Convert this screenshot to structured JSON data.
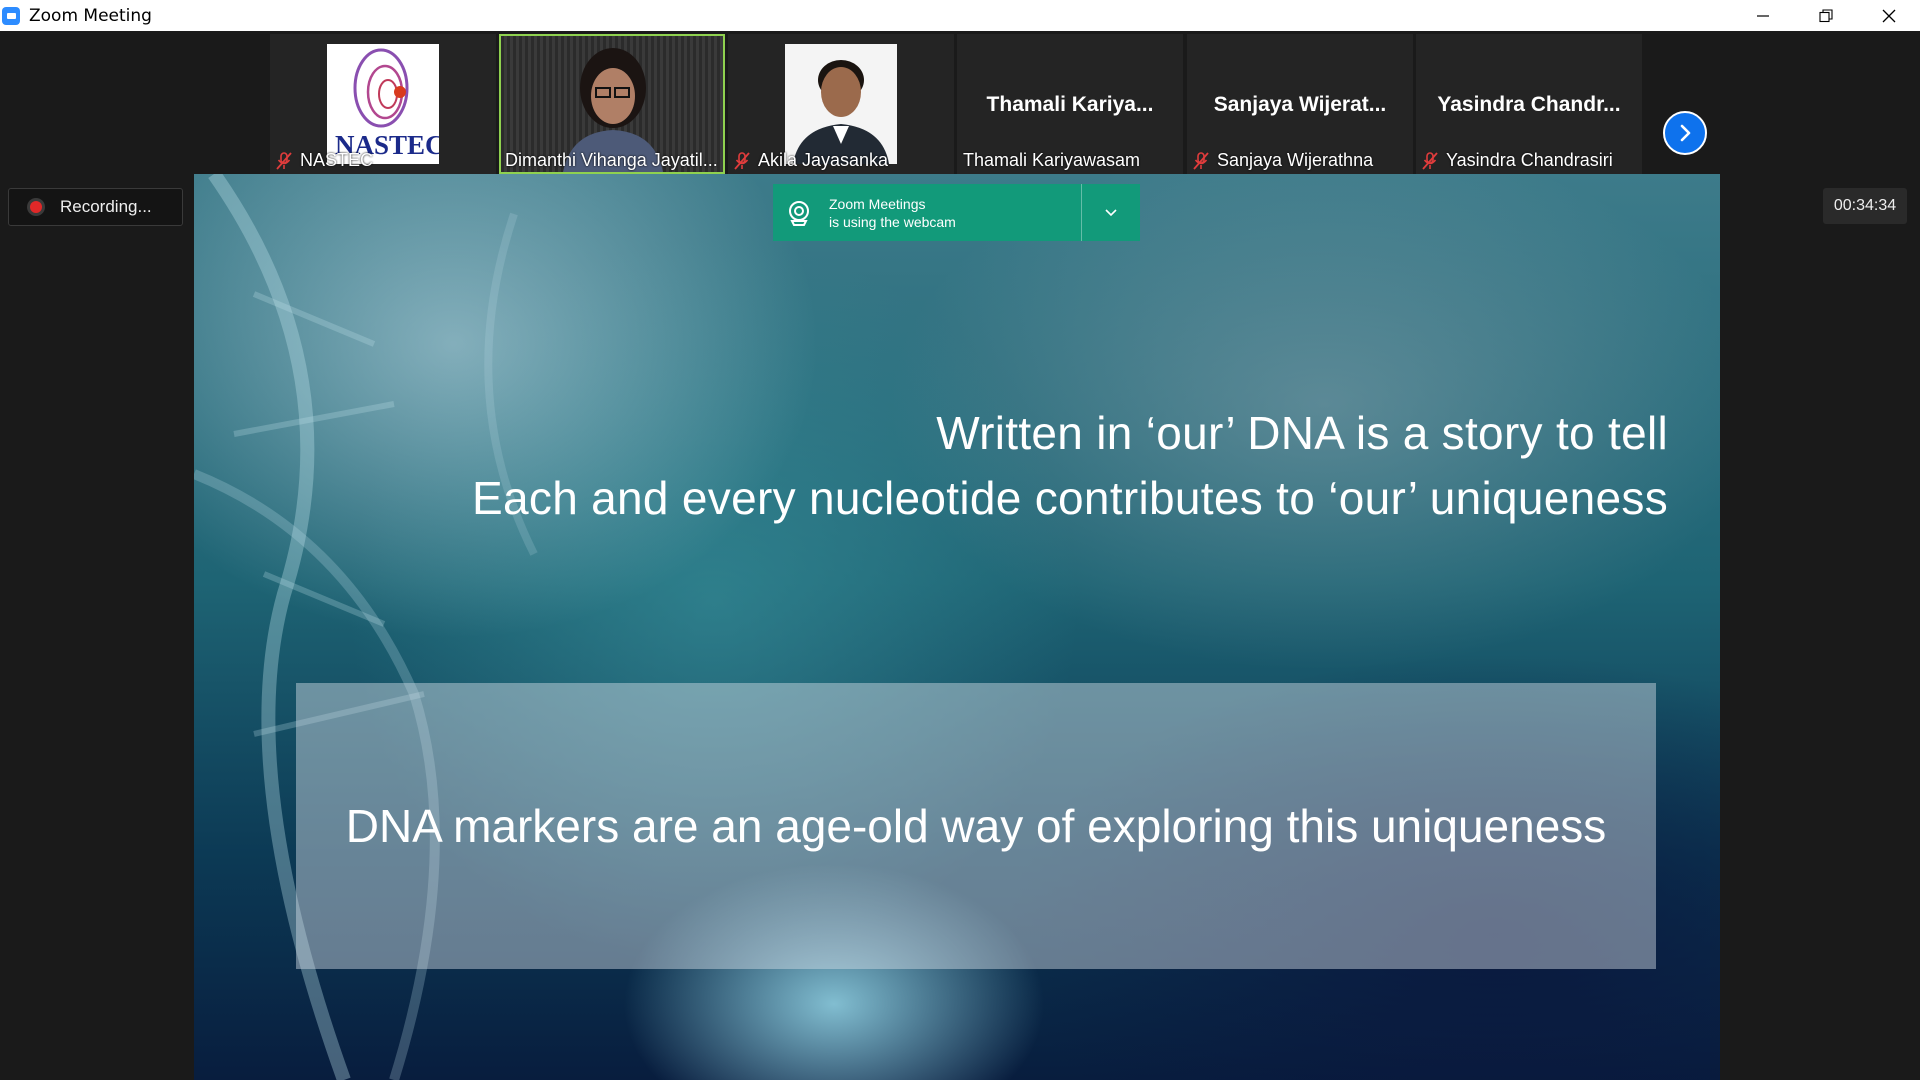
{
  "window": {
    "title": "Zoom Meeting",
    "minimize": "–",
    "restore": "❐",
    "close": "✕"
  },
  "participants": [
    {
      "display_name": "NASTEC",
      "muted": true,
      "type": "logo"
    },
    {
      "display_name": "Dimanthi Vihanga Jayatil...",
      "muted": false,
      "type": "video",
      "active_speaker": true
    },
    {
      "display_name": "Akila Jayasanka",
      "muted": true,
      "type": "photo"
    },
    {
      "tile_name": "Thamali  Kariya...",
      "display_name": "Thamali Kariyawasam",
      "muted": false,
      "type": "name"
    },
    {
      "tile_name": "Sanjaya  Wijerat...",
      "display_name": "Sanjaya Wijerathna",
      "muted": true,
      "type": "name"
    },
    {
      "tile_name": "Yasindra  Chandr...",
      "display_name": "Yasindra Chandrasiri",
      "muted": true,
      "type": "name"
    }
  ],
  "logo_text": "NASTEC",
  "recording": {
    "label": "Recording..."
  },
  "timer": "00:34:34",
  "notification": {
    "line1": "Zoom Meetings",
    "line2": "is using the webcam"
  },
  "slide": {
    "line1": "Written in ‘our’ DNA is a story to tell",
    "line2": "Each and every nucleotide contributes to ‘our’ uniqueness",
    "box_text": "DNA markers are an age-old way of exploring this uniqueness"
  },
  "colors": {
    "accent": "#0e72ed",
    "active_speaker_border": "#8fd14f",
    "recording_dot": "#e02828",
    "notification_bg": "#129a7a",
    "mute_icon": "#e03c3c"
  },
  "icons": {
    "app": "zoom-app-icon",
    "mute": "microphone-muted-icon",
    "next": "chevron-right-icon",
    "webcam": "webcam-icon",
    "dropdown": "chevron-down-icon"
  }
}
